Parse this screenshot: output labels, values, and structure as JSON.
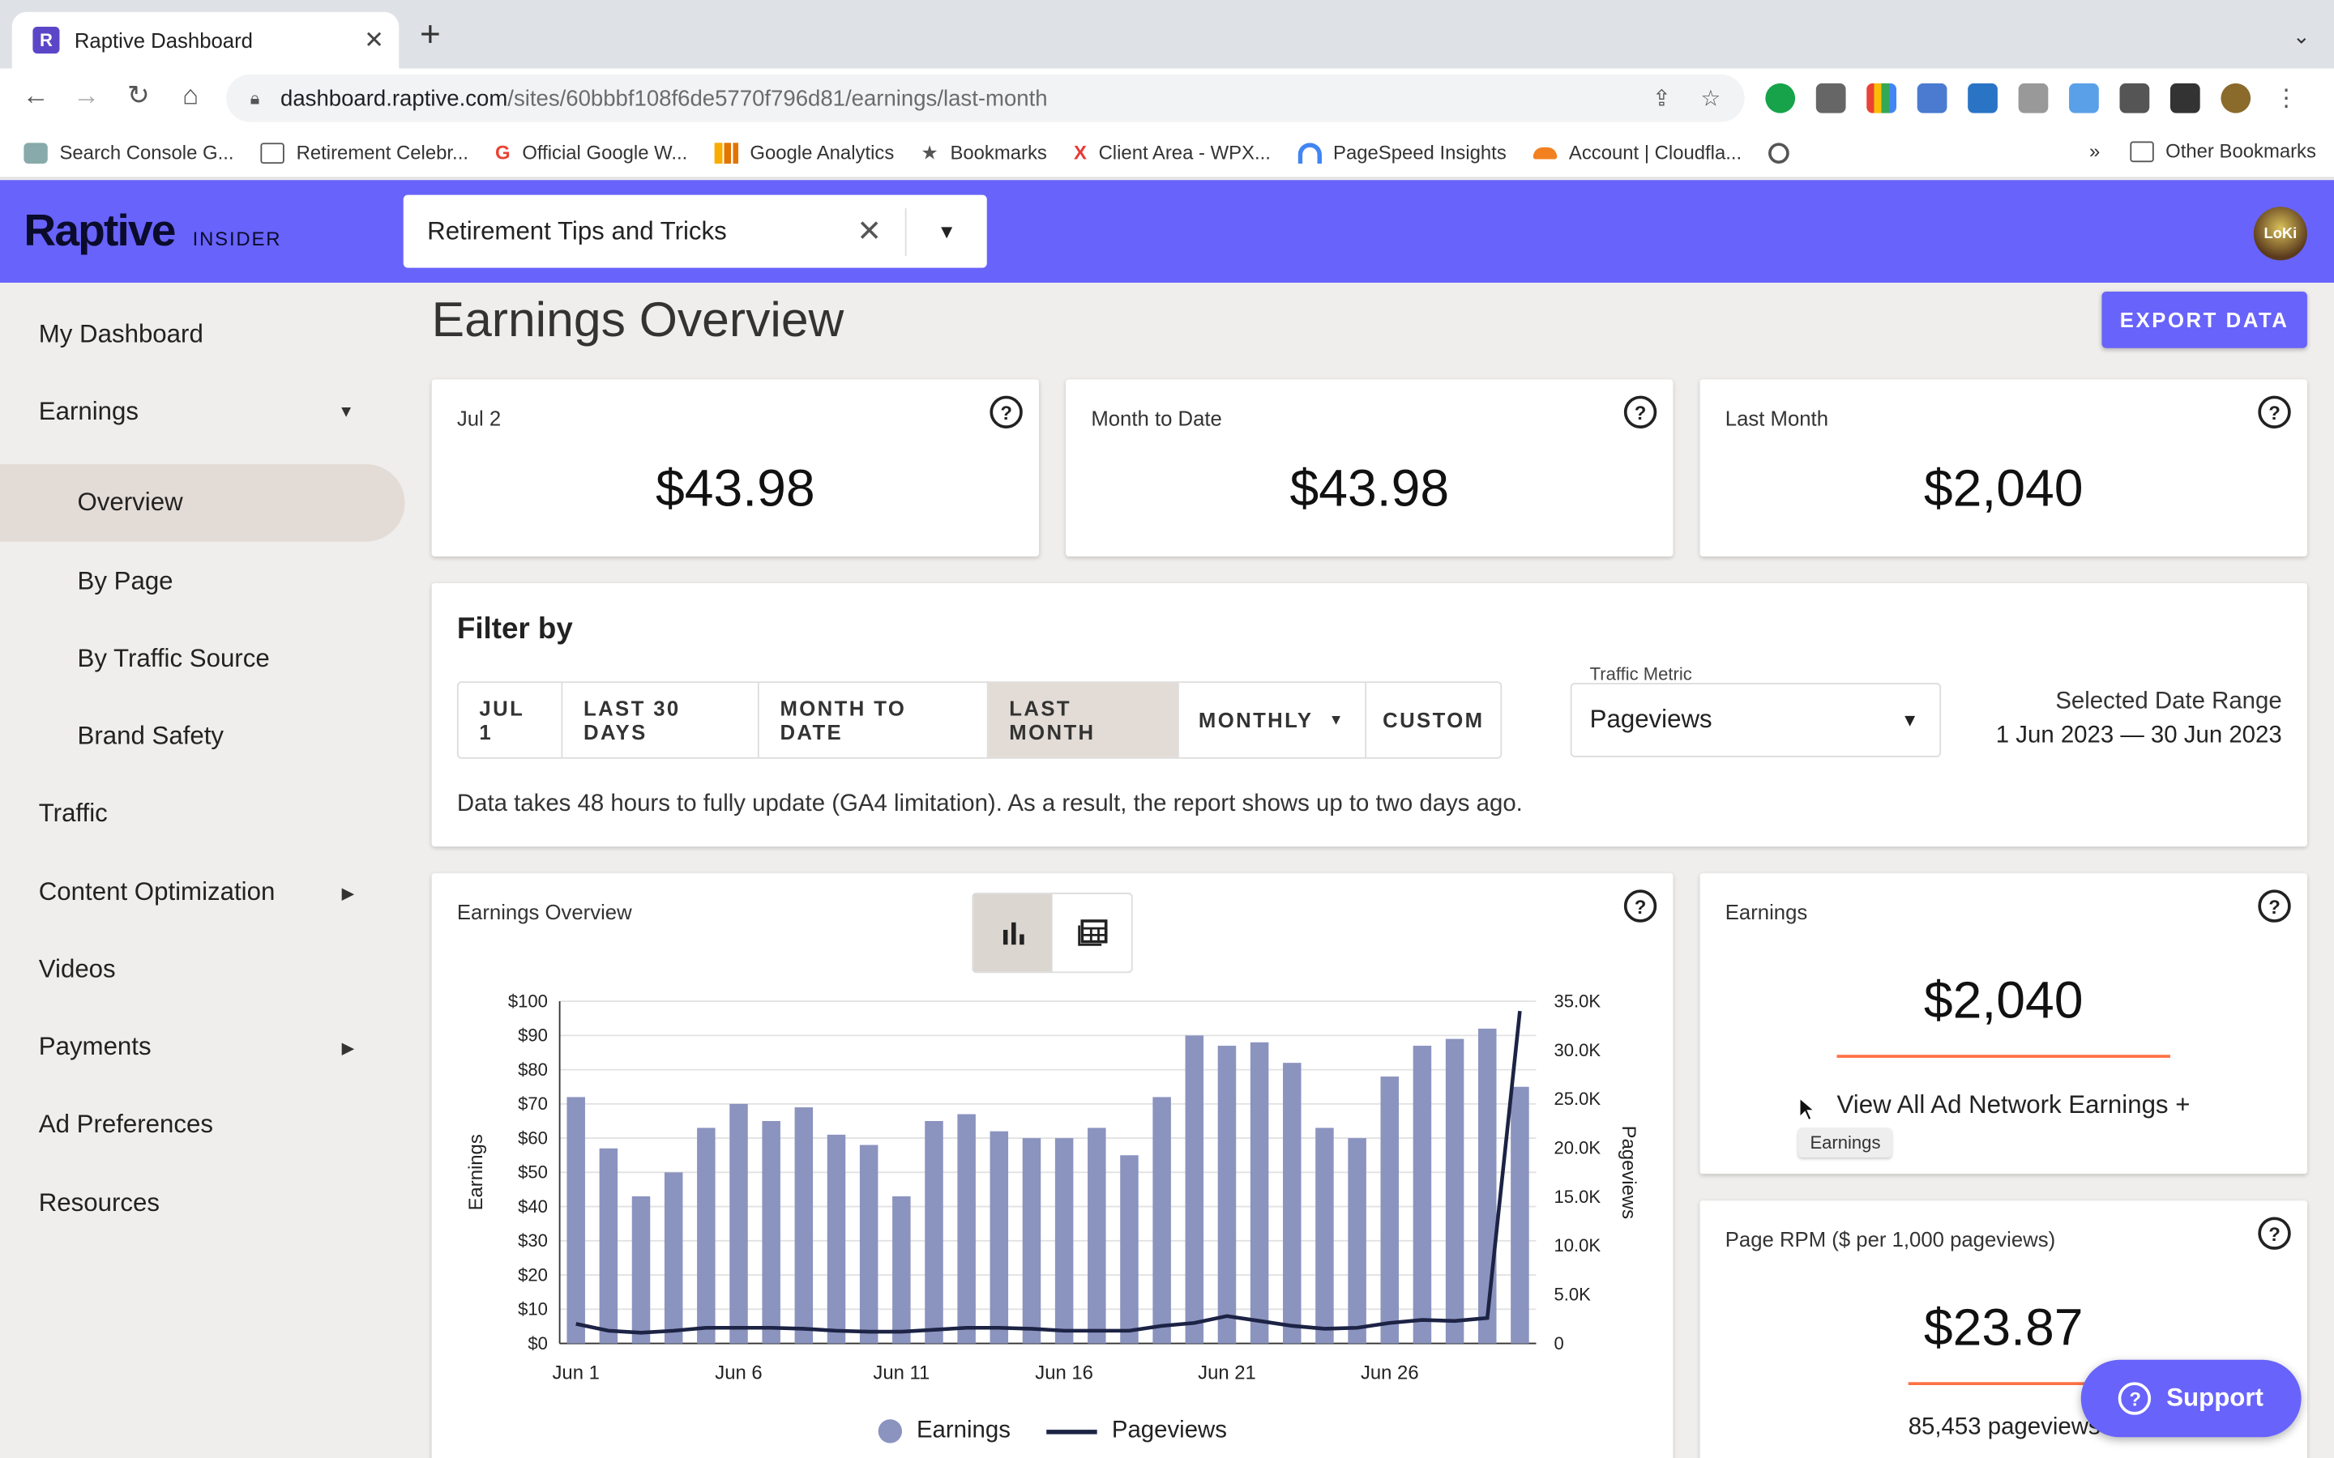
{
  "browser": {
    "tab_title": "Raptive Dashboard",
    "tab_favicon": "R",
    "url_host": "dashboard.raptive.com",
    "url_path": "/sites/60bbbf108f6de5770f796d81/earnings/last-month",
    "bookmarks": [
      {
        "label": "Search Console G...",
        "icon": "search-console-icon"
      },
      {
        "label": "Retirement Celebr...",
        "icon": "folder-icon"
      },
      {
        "label": "Official Google W...",
        "icon": "google-icon"
      },
      {
        "label": "Google Analytics",
        "icon": "analytics-icon"
      },
      {
        "label": "Bookmarks",
        "icon": "star-icon"
      },
      {
        "label": "Client Area - WPX...",
        "icon": "wpx-icon"
      },
      {
        "label": "PageSpeed Insights",
        "icon": "pagespeed-icon"
      },
      {
        "label": "Account | Cloudfla...",
        "icon": "cloudflare-icon"
      }
    ],
    "bookmarks_overflow": "»",
    "other_bookmarks": "Other Bookmarks"
  },
  "header": {
    "brand": "Raptive",
    "brand_sub": "INSIDER",
    "site_name": "Retirement Tips and Tricks",
    "avatar_text": "LoKi",
    "accent": "#6863fb"
  },
  "sidebar": {
    "items": [
      {
        "label": "My Dashboard"
      },
      {
        "label": "Earnings",
        "caret": "▼"
      },
      {
        "label": "Overview"
      },
      {
        "label": "By Page"
      },
      {
        "label": "By Traffic Source"
      },
      {
        "label": "Brand Safety"
      },
      {
        "label": "Traffic"
      },
      {
        "label": "Content Optimization",
        "caret": "▶"
      },
      {
        "label": "Videos"
      },
      {
        "label": "Payments",
        "caret": "▶"
      },
      {
        "label": "Ad Preferences"
      },
      {
        "label": "Resources"
      }
    ]
  },
  "main": {
    "title": "Earnings Overview",
    "export_label": "EXPORT DATA",
    "stats": [
      {
        "label": "Jul 2",
        "value": "$43.98"
      },
      {
        "label": "Month to Date",
        "value": "$43.98"
      },
      {
        "label": "Last Month",
        "value": "$2,040"
      }
    ],
    "filter": {
      "title": "Filter by",
      "buttons": [
        "JUL 1",
        "LAST 30 DAYS",
        "MONTH TO DATE",
        "LAST MONTH",
        "MONTHLY",
        "CUSTOM"
      ],
      "monthly_caret": "▼",
      "metric_label": "Traffic Metric",
      "metric_value": "Pageviews",
      "range_label": "Selected Date Range",
      "range_value": "1 Jun 2023 — 30 Jun 2023",
      "note": "Data takes 48 hours to fully update (GA4 limitation). As a result, the report shows up to two days ago."
    },
    "chart_card": {
      "title": "Earnings Overview",
      "legend_earnings": "Earnings",
      "legend_pageviews": "Pageviews"
    },
    "earnings_card": {
      "label": "Earnings",
      "value": "$2,040",
      "link": "View All Ad Network Earnings +",
      "tooltip": "Earnings"
    },
    "rpm_card": {
      "label": "Page RPM ($ per 1,000 pageviews)",
      "value": "$23.87",
      "sub": "85,453 pageviews"
    },
    "support_label": "Support"
  },
  "chart_data": {
    "type": "bar",
    "title": "",
    "xlabel": "",
    "ylabel": "Earnings",
    "y2label": "Pageviews",
    "x": [
      "Jun 1",
      "Jun 2",
      "Jun 3",
      "Jun 4",
      "Jun 5",
      "Jun 6",
      "Jun 7",
      "Jun 8",
      "Jun 9",
      "Jun 10",
      "Jun 11",
      "Jun 12",
      "Jun 13",
      "Jun 14",
      "Jun 15",
      "Jun 16",
      "Jun 17",
      "Jun 18",
      "Jun 19",
      "Jun 20",
      "Jun 21",
      "Jun 22",
      "Jun 23",
      "Jun 24",
      "Jun 25",
      "Jun 26",
      "Jun 27",
      "Jun 28",
      "Jun 29",
      "Jun 30"
    ],
    "xticks": [
      "Jun 1",
      "Jun 6",
      "Jun 11",
      "Jun 16",
      "Jun 21",
      "Jun 26"
    ],
    "ylim": [
      0,
      100
    ],
    "y2lim": [
      0,
      35000
    ],
    "yticks": [
      "$0",
      "$10",
      "$20",
      "$30",
      "$40",
      "$50",
      "$60",
      "$70",
      "$80",
      "$90",
      "$100"
    ],
    "y2ticks": [
      "0",
      "5.0K",
      "10.0K",
      "15.0K",
      "20.0K",
      "25.0K",
      "30.0K",
      "35.0K"
    ],
    "series": [
      {
        "name": "Earnings",
        "type": "bar",
        "axis": "left",
        "color": "#8b93bf",
        "values": [
          72,
          57,
          43,
          50,
          63,
          70,
          65,
          69,
          61,
          58,
          43,
          65,
          67,
          62,
          60,
          60,
          63,
          55,
          72,
          90,
          87,
          88,
          82,
          63,
          60,
          78,
          87,
          89,
          92,
          75
        ]
      },
      {
        "name": "Pageviews",
        "type": "line",
        "axis": "right",
        "color": "#1c2344",
        "values": [
          2000,
          1300,
          1100,
          1300,
          1600,
          1600,
          1600,
          1500,
          1300,
          1200,
          1200,
          1400,
          1600,
          1600,
          1500,
          1300,
          1300,
          1300,
          1800,
          2100,
          2800,
          2300,
          1800,
          1500,
          1600,
          2100,
          2400,
          2300,
          2600,
          34000
        ]
      }
    ],
    "legend": "bottom",
    "grid": true
  }
}
